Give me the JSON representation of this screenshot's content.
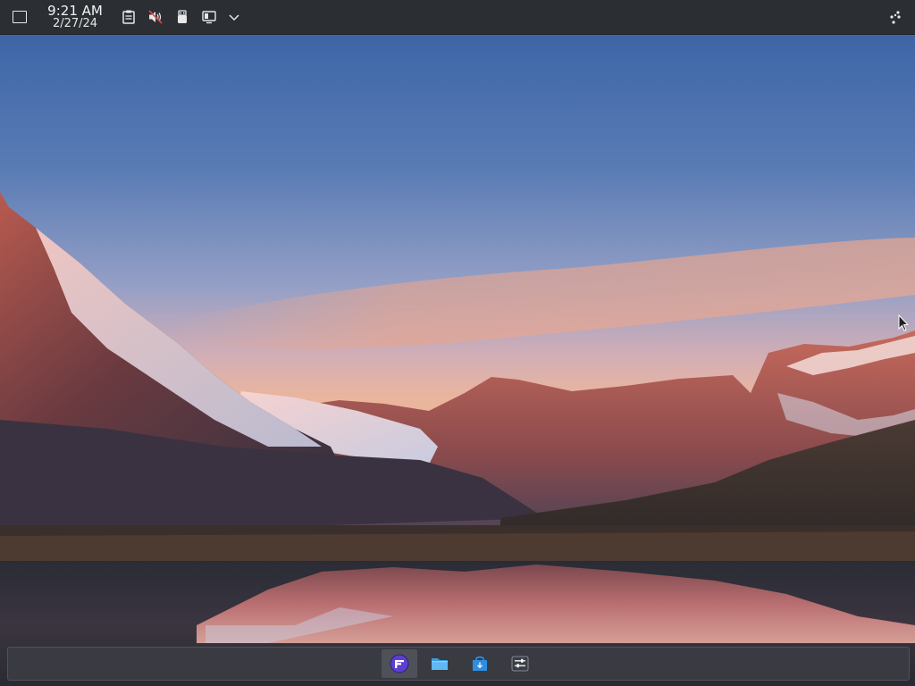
{
  "top_panel": {
    "clock": {
      "time": "9:21 AM",
      "date": "2/27/24"
    },
    "tray_icons": [
      "clipboard-icon",
      "volume-muted-icon",
      "removable-device-icon",
      "display-icon",
      "expand-tray-chevron-icon"
    ],
    "right_icon": "activities-icon"
  },
  "dock": {
    "items": [
      {
        "name": "app-launcher-icon",
        "active": true
      },
      {
        "name": "file-manager-icon",
        "active": false
      },
      {
        "name": "software-store-icon",
        "active": false
      },
      {
        "name": "system-settings-icon",
        "active": false
      }
    ]
  },
  "colors": {
    "panel_bg": "#2b2e33",
    "dock_bg": "#3c3e44",
    "accent": "#5b3fd1"
  }
}
